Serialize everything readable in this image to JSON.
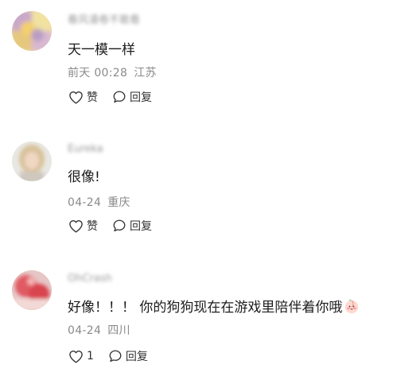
{
  "comments": [
    {
      "username": "春风漫卷不敢看",
      "text": "天一模一样",
      "date": "前天 00:28",
      "location": "江苏",
      "like_label": "赞",
      "reply_label": "回复",
      "avatar": "blurred-avatar-yellow"
    },
    {
      "username": "Eureka",
      "text": "很像!",
      "date": "04-24",
      "location": "重庆",
      "like_label": "赞",
      "reply_label": "回复",
      "avatar": "blurred-avatar-portrait"
    },
    {
      "username": "OhCrash",
      "text": "好像！！！ 你的狗狗现在在游戏里陪伴着你哦",
      "emoji": "smiling-peach-emoji",
      "date": "04-24",
      "location": "四川",
      "like_label": "1",
      "reply_label": "回复",
      "avatar": "blurred-avatar-red"
    }
  ],
  "icons": {
    "like": "heart-outline-icon",
    "reply": "speech-bubble-icon"
  },
  "colors": {
    "text_primary": "#1c1c1c",
    "text_meta": "#8a8a8a",
    "icon": "#333333"
  }
}
